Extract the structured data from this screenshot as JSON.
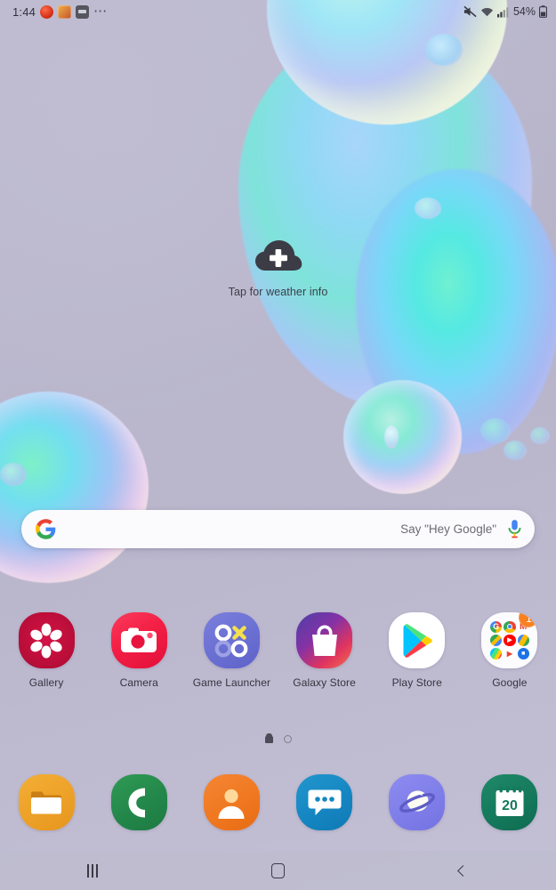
{
  "status_bar": {
    "time": "1:44",
    "notification_icons": [
      "red-dot-icon",
      "game-icon",
      "card-icon",
      "more-dots-icon"
    ],
    "mute_icon": "mute-icon",
    "wifi_icon": "wifi-icon",
    "signal_icon": "signal-bars-icon",
    "battery_percent": "54%",
    "battery_icon": "battery-icon"
  },
  "weather_widget": {
    "icon": "cloud-plus-icon",
    "label": "Tap for weather info"
  },
  "search": {
    "google_logo": "google-g-icon",
    "placeholder": "Say \"Hey Google\"",
    "mic_icon": "microphone-icon"
  },
  "home_apps": [
    {
      "label": "Gallery",
      "icon": "gallery-icon",
      "badge": ""
    },
    {
      "label": "Camera",
      "icon": "camera-icon",
      "badge": ""
    },
    {
      "label": "Game Launcher",
      "icon": "game-launcher-icon",
      "badge": ""
    },
    {
      "label": "Galaxy Store",
      "icon": "galaxy-store-icon",
      "badge": ""
    },
    {
      "label": "Play Store",
      "icon": "play-store-icon",
      "badge": ""
    },
    {
      "label": "Google",
      "icon": "google-folder-icon",
      "badge": "1"
    }
  ],
  "google_folder_apps": [
    "google-icon",
    "chrome-icon",
    "gmail-icon",
    "maps-icon",
    "youtube-icon",
    "drive-icon",
    "play-store-icon",
    "play-movies-icon",
    "meet-icon"
  ],
  "page_indicator": {
    "pages": 2,
    "active": 0
  },
  "dock_apps": [
    {
      "label": "My Files",
      "icon": "folder-icon"
    },
    {
      "label": "Phone",
      "icon": "phone-icon"
    },
    {
      "label": "Contacts",
      "icon": "contacts-icon"
    },
    {
      "label": "Messages",
      "icon": "message-bubble-icon"
    },
    {
      "label": "Internet",
      "icon": "internet-planet-icon"
    },
    {
      "label": "Calendar",
      "icon": "calendar-icon"
    }
  ],
  "calendar_day": "20",
  "nav_bar": {
    "recents": "recents-icon",
    "home": "home-icon",
    "back": "back-icon"
  },
  "colors": {
    "wallpaper_base": "#b9b6cc",
    "badge": "#f98020",
    "search_bg": "#fbfbfd",
    "label_text": "#35353f"
  }
}
